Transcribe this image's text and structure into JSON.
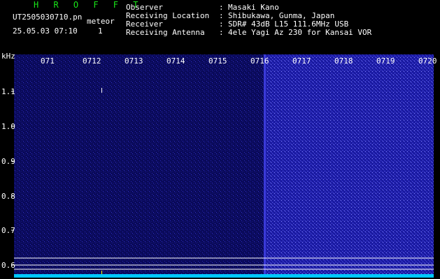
{
  "header": {
    "title": "H R O F F T",
    "filename": "UT2505030710.pn",
    "kind": "meteor",
    "datetime": "25.05.03 07:10",
    "count": "1"
  },
  "meta": [
    {
      "label": "Observer",
      "value": "Masaki Kano"
    },
    {
      "label": "Receiving Location",
      "value": "Shibukawa, Gunma, Japan"
    },
    {
      "label": "Receiver",
      "value": "SDR# 43dB L15 111.6MHz USB"
    },
    {
      "label": "Receiving Antenna",
      "value": "4ele Yagi Az 230 for Kansai VOR"
    }
  ],
  "meta_sep": ":",
  "yaxis": {
    "unit": "kHz",
    "ticks": [
      "1.1",
      "1.0",
      "0.9",
      "0.8",
      "0.7",
      "0.6"
    ]
  },
  "xaxis": {
    "ticks": [
      "071",
      "0712",
      "0713",
      "0714",
      "0715",
      "0716",
      "0717",
      "0718",
      "0719",
      "0720"
    ]
  },
  "colors": {
    "background": "#000000",
    "spectrum_left": "#0a0a5a",
    "spectrum_right": "#1a1aa0",
    "title": "#19e619",
    "baseline": "#00c8ff"
  }
}
